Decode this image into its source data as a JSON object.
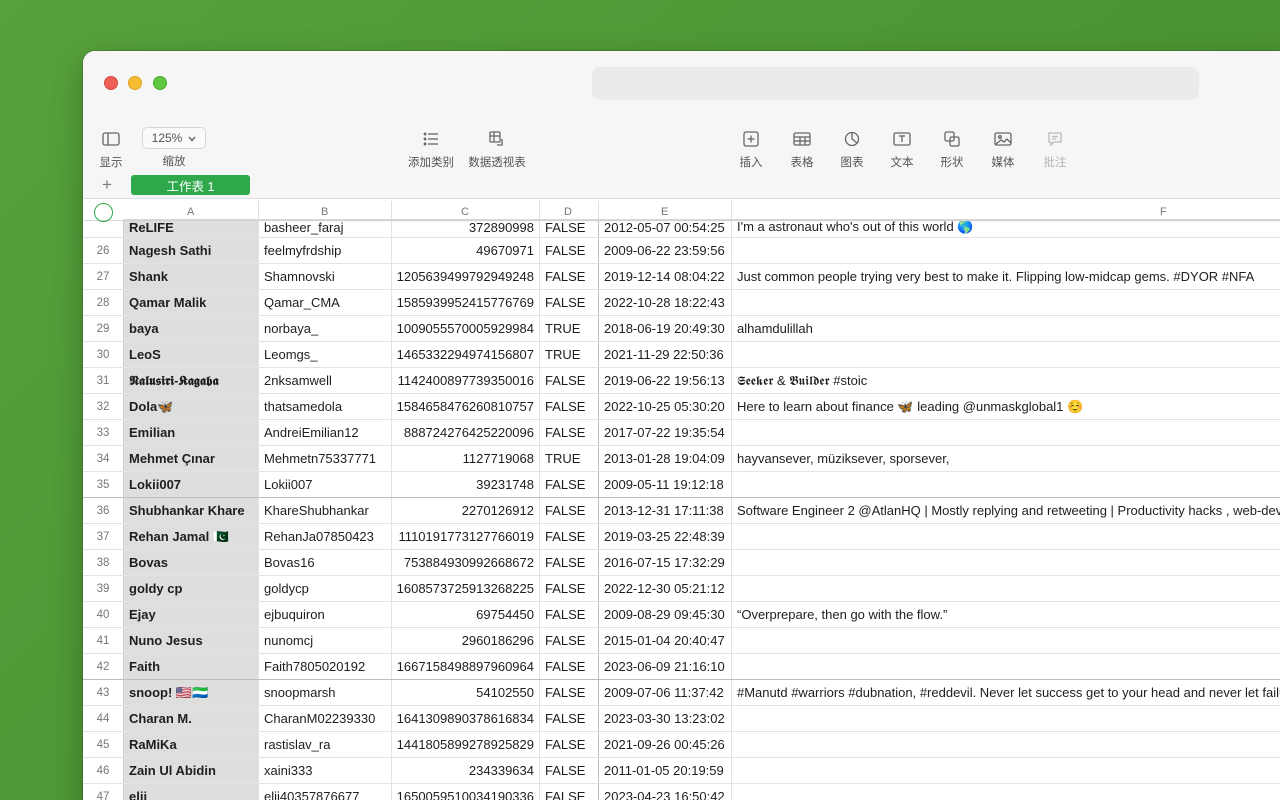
{
  "toolbar": {
    "display_label": "显示",
    "zoom_value": "125%",
    "zoom_label": "缩放",
    "add_category_label": "添加类别",
    "pivot_label": "数据透视表",
    "insert_label": "插入",
    "table_label": "表格",
    "chart_label": "图表",
    "text_label": "文本",
    "shape_label": "形状",
    "media_label": "媒体",
    "comment_label": "批注"
  },
  "sheetbar": {
    "add_symbol": "+",
    "active_sheet": "工作表 1"
  },
  "columns": [
    "A",
    "B",
    "C",
    "D",
    "E",
    "F"
  ],
  "top_partial_row": {
    "a": "ReLIFE",
    "b": "basheer_faraj",
    "c": "372890998",
    "d": "FALSE",
    "e": "2012-05-07 00:54:25",
    "f": "I'm a astronaut who's out of this world 🌎"
  },
  "rows": [
    {
      "n": "26",
      "a": "Nagesh Sathi",
      "b": "feelmyfrdship",
      "c": "49670971",
      "d": "FALSE",
      "e": "2009-06-22 23:59:56",
      "f": ""
    },
    {
      "n": "27",
      "a": "Shank",
      "b": "Shamnovski",
      "c": "1205639499792949248",
      "d": "FALSE",
      "e": "2019-12-14 08:04:22",
      "f": "Just common people trying very best to make it. Flipping low-midcap gems. #DYOR #NFA"
    },
    {
      "n": "28",
      "a": "Qamar Malik",
      "b": "Qamar_CMA",
      "c": "1585939952415776769",
      "d": "FALSE",
      "e": "2022-10-28 18:22:43",
      "f": ""
    },
    {
      "n": "29",
      "a": "baya",
      "b": "norbaya_",
      "c": "1009055570005929984",
      "d": "TRUE",
      "e": "2018-06-19 20:49:30",
      "f": "alhamdulillah"
    },
    {
      "n": "30",
      "a": "LeoS",
      "b": "Leomgs_",
      "c": "1465332294974156807",
      "d": "TRUE",
      "e": "2021-11-29 22:50:36",
      "f": ""
    },
    {
      "n": "31",
      "a": "𝕹𝖆𝖑𝖚𝖘𝖎𝖗𝖎-𝕶𝖆𝖌𝖆𝖇𝖆",
      "b": "2nksamwell",
      "c": "1142400897739350016",
      "d": "FALSE",
      "e": "2019-06-22 19:56:13",
      "f": "𝕾𝖊𝖊𝖐𝖊𝖗 & 𝕭𝖚𝖎𝖑𝖉𝖊𝖗 #stoic"
    },
    {
      "n": "32",
      "a": "Dola🦋",
      "b": "thatsamedola",
      "c": "1584658476260810757",
      "d": "FALSE",
      "e": "2022-10-25 05:30:20",
      "f": "Here to learn about finance 🦋 leading @unmaskglobal1 ☺️"
    },
    {
      "n": "33",
      "a": "Emilian",
      "b": "AndreiEmilian12",
      "c": "888724276425220096",
      "d": "FALSE",
      "e": "2017-07-22 19:35:54",
      "f": ""
    },
    {
      "n": "34",
      "a": "Mehmet Çınar",
      "b": "Mehmetn75337771",
      "c": "1127719068",
      "d": "TRUE",
      "e": "2013-01-28 19:04:09",
      "f": "hayvansever, müziksever, sporsever,"
    },
    {
      "n": "35",
      "a": "Lokii007",
      "b": "Lokii007",
      "c": "39231748",
      "d": "FALSE",
      "e": "2009-05-11 19:12:18",
      "f": ""
    },
    {
      "n": "36",
      "a": "Shubhankar Khare",
      "b": "KhareShubhankar",
      "c": "2270126912",
      "d": "FALSE",
      "e": "2013-12-31 17:11:38",
      "f": "Software Engineer 2 @AtlanHQ | Mostly replying and retweeting | Productivity hacks , web-dev"
    },
    {
      "n": "37",
      "a": "Rehan Jamal 🇵🇰",
      "b": "RehanJa07850423",
      "c": "1110191773127766019",
      "d": "FALSE",
      "e": "2019-03-25 22:48:39",
      "f": ""
    },
    {
      "n": "38",
      "a": "Bovas",
      "b": "Bovas16",
      "c": "753884930992668672",
      "d": "FALSE",
      "e": "2016-07-15 17:32:29",
      "f": ""
    },
    {
      "n": "39",
      "a": "goldy cp",
      "b": "goldycp",
      "c": "1608573725913268225",
      "d": "FALSE",
      "e": "2022-12-30 05:21:12",
      "f": ""
    },
    {
      "n": "40",
      "a": "Ejay",
      "b": "ejbuquiron",
      "c": "69754450",
      "d": "FALSE",
      "e": "2009-08-29 09:45:30",
      "f": "“Overprepare, then go with the flow.”"
    },
    {
      "n": "41",
      "a": "Nuno Jesus",
      "b": "nunomcj",
      "c": "2960186296",
      "d": "FALSE",
      "e": "2015-01-04 20:40:47",
      "f": ""
    },
    {
      "n": "42",
      "a": "Faith",
      "b": "Faith7805020192",
      "c": "1667158498897960964",
      "d": "FALSE",
      "e": "2023-06-09 21:16:10",
      "f": ""
    },
    {
      "n": "43",
      "a": "snoop! 🇺🇸🇸🇱",
      "b": "snoopmarsh",
      "c": "54102550",
      "d": "FALSE",
      "e": "2009-07-06 11:37:42",
      "f": "#Manutd #warriors #dubnation, #reddevil. Never let success get to your head and never let failure"
    },
    {
      "n": "44",
      "a": "Charan M.",
      "b": "CharanM02239330",
      "c": "1641309890378616834",
      "d": "FALSE",
      "e": "2023-03-30 13:23:02",
      "f": ""
    },
    {
      "n": "45",
      "a": "RaMiKa",
      "b": "rastislav_ra",
      "c": "1441805899278925829",
      "d": "FALSE",
      "e": "2021-09-26 00:45:26",
      "f": ""
    },
    {
      "n": "46",
      "a": "Zain Ul Abidin",
      "b": "xaini333",
      "c": "234339634",
      "d": "FALSE",
      "e": "2011-01-05 20:19:59",
      "f": ""
    },
    {
      "n": "47",
      "a": "elii",
      "b": "elii40357876677",
      "c": "1650059510034190336",
      "d": "FALSE",
      "e": "2023-04-23 16:50:42",
      "f": ""
    }
  ]
}
